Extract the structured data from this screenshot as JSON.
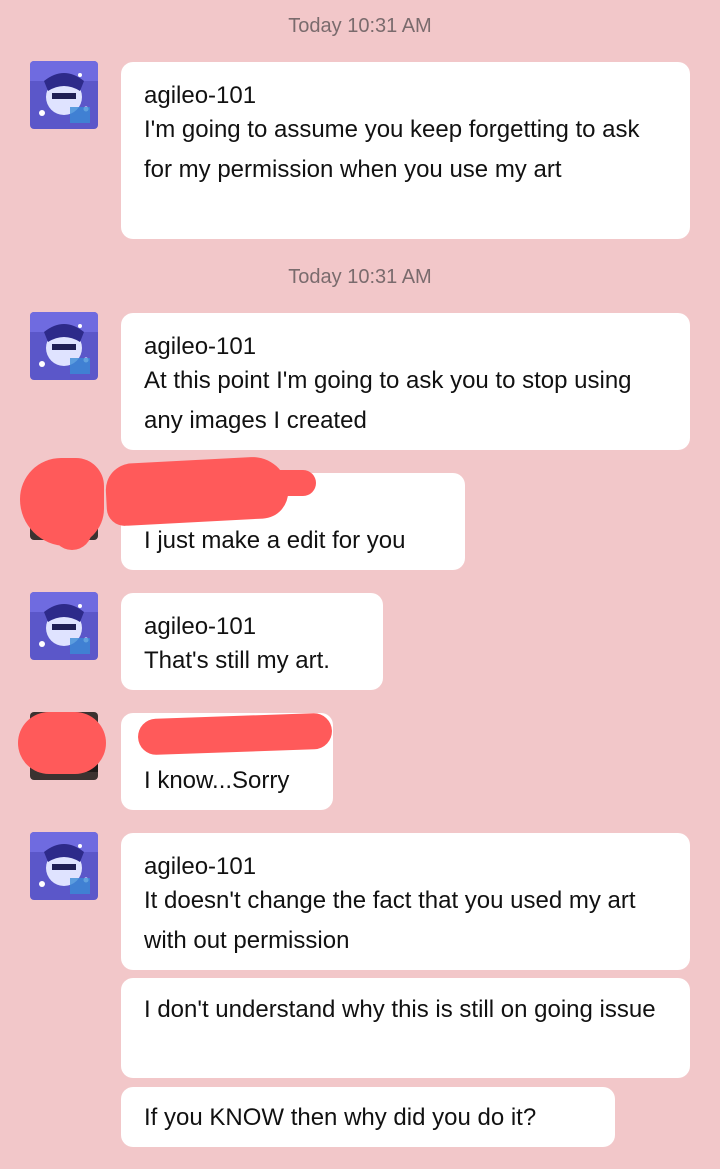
{
  "colors": {
    "background": "#f2c7c9",
    "bubble": "#ffffff",
    "text": "#111111",
    "timestamp": "#7a6b6d",
    "redaction": "#ff5a5a"
  },
  "timestamps": [
    "Today 10:31 AM",
    "Today 10:31 AM"
  ],
  "messages": [
    {
      "sender": "agileo-101",
      "text": "I'm going to assume you keep forgetting to ask for my permission when you use my art",
      "avatar": "anime-avatar-icon"
    },
    {
      "sender": "agileo-101",
      "text": "At this point I'm going to ask you to stop using any images I created",
      "avatar": "anime-avatar-icon"
    },
    {
      "sender": "",
      "text": "I just make a edit for you",
      "avatar": "redacted-avatar-icon"
    },
    {
      "sender": "agileo-101",
      "text": "That's still my art.",
      "avatar": "anime-avatar-icon"
    },
    {
      "sender": "",
      "text": "I know...Sorry",
      "avatar": "redacted-avatar-icon"
    },
    {
      "sender": "agileo-101",
      "text": "It doesn't change the fact that you used my art with out permission",
      "avatar": "anime-avatar-icon"
    },
    {
      "sender": "",
      "text": "I don't understand why this is still on going issue",
      "avatar": ""
    },
    {
      "sender": "",
      "text": "If you KNOW then why did you do it?",
      "avatar": ""
    }
  ]
}
